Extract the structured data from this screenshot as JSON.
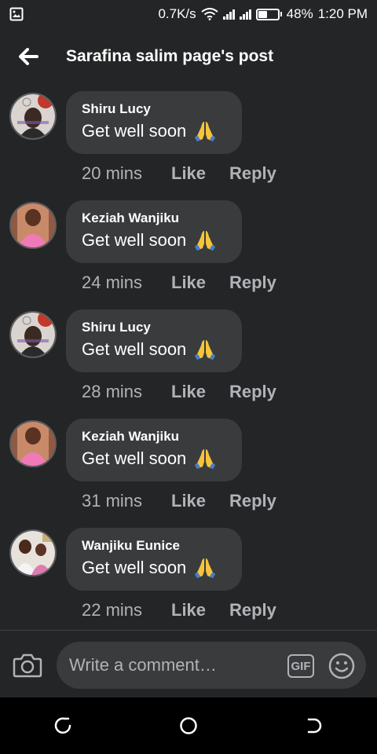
{
  "status_bar": {
    "speed": "0.7K/s",
    "battery": "48%",
    "battery_level": 0.48,
    "time": "1:20 PM"
  },
  "header": {
    "title": "Sarafina salim page's post"
  },
  "comments": [
    {
      "author": "Shiru Lucy",
      "text": "Get well soon",
      "time": "20 mins",
      "like": "Like",
      "reply": "Reply"
    },
    {
      "author": "Keziah Wanjiku",
      "text": "Get well soon",
      "time": "24 mins",
      "like": "Like",
      "reply": "Reply"
    },
    {
      "author": "Shiru Lucy",
      "text": "Get well soon",
      "time": "28 mins",
      "like": "Like",
      "reply": "Reply"
    },
    {
      "author": "Keziah Wanjiku",
      "text": "Get well soon",
      "time": "31 mins",
      "like": "Like",
      "reply": "Reply"
    },
    {
      "author": "Wanjiku Eunice",
      "text": "Get well soon",
      "time": "22 mins",
      "like": "Like",
      "reply": "Reply"
    }
  ],
  "composer": {
    "placeholder": "Write a comment…",
    "gif_label": "GIF"
  }
}
